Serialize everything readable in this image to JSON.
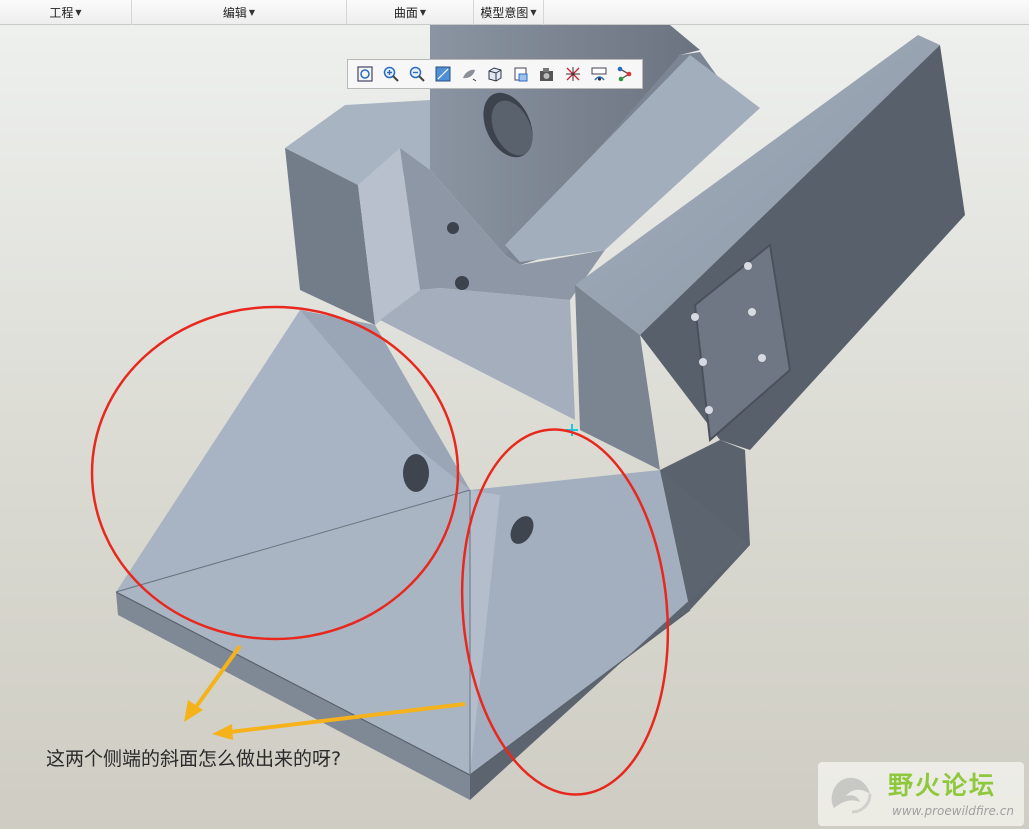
{
  "menubar": {
    "items": [
      {
        "label": "工程"
      },
      {
        "label": "编辑"
      },
      {
        "label": "曲面"
      },
      {
        "label": "模型意图"
      }
    ]
  },
  "toolbar": {
    "icons": [
      "refit-icon",
      "zoom-in-icon",
      "zoom-out-icon",
      "reorient-icon",
      "display-style-icon",
      "shading-icon",
      "saved-views-icon",
      "layers-icon",
      "datum-display-icon",
      "appearance-icon",
      "annotation-icon"
    ]
  },
  "annotation": {
    "question": "这两个侧端的斜面怎么做出来的呀?",
    "circle_color": "#e8281e",
    "arrow_color": "#f6b21a"
  },
  "watermark": {
    "title": "野火论坛",
    "url": "www.proewildfire.cn"
  }
}
